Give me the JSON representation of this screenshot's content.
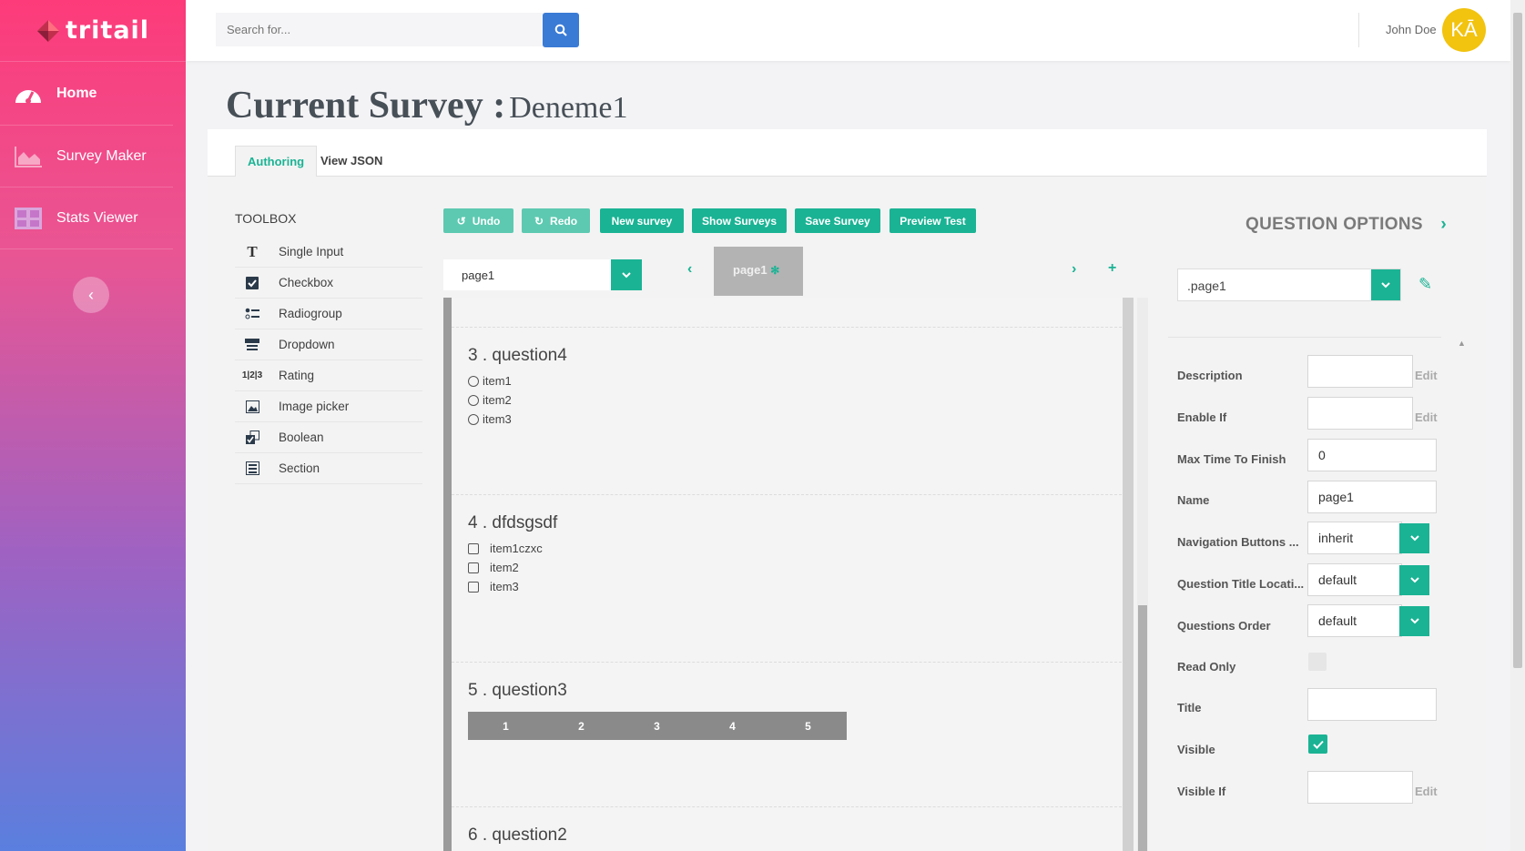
{
  "sidebar": {
    "logo_text": "tritail",
    "items": [
      {
        "label": "Home",
        "icon": "dashboard-gauge-icon"
      },
      {
        "label": "Survey Maker",
        "icon": "area-chart-icon"
      },
      {
        "label": "Stats Viewer",
        "icon": "grid-table-icon"
      }
    ],
    "collapse_icon": "chevron-left-icon"
  },
  "topbar": {
    "search_placeholder": "Search for...",
    "user_name": "John Doe",
    "avatar_initials": "KĀ",
    "avatar_color": "#f2c30f"
  },
  "page": {
    "title": "Current Survey :",
    "survey_name": "Deneme1"
  },
  "tabs": [
    {
      "label": "Authoring",
      "active": true
    },
    {
      "label": "View JSON",
      "active": false
    }
  ],
  "toolbox": {
    "title": "TOOLBOX",
    "items": [
      {
        "label": "Single Input",
        "icon": "text-t-icon"
      },
      {
        "label": "Checkbox",
        "icon": "checkbox-icon"
      },
      {
        "label": "Radiogroup",
        "icon": "radiogroup-icon"
      },
      {
        "label": "Dropdown",
        "icon": "dropdown-icon"
      },
      {
        "label": "Rating",
        "icon": "rating-icon"
      },
      {
        "label": "Image picker",
        "icon": "image-icon"
      },
      {
        "label": "Boolean",
        "icon": "boolean-icon"
      },
      {
        "label": "Section",
        "icon": "section-icon"
      }
    ]
  },
  "toolbar": {
    "undo": "Undo",
    "redo": "Redo",
    "new_survey": "New survey",
    "show_surveys": "Show Surveys",
    "save_survey": "Save Survey",
    "preview_test": "Preview Test"
  },
  "page_selector": {
    "value": "page1",
    "chip_label": "page1"
  },
  "questions": [
    {
      "number": "3 .",
      "title": "question4",
      "type": "radiogroup",
      "options": [
        "item1",
        "item2",
        "item3"
      ]
    },
    {
      "number": "4 .",
      "title": "dfdsgsdf",
      "type": "checkbox",
      "options": [
        "item1czxc",
        "item2",
        "item3"
      ]
    },
    {
      "number": "5 .",
      "title": "question3",
      "type": "rating",
      "options": [
        "1",
        "2",
        "3",
        "4",
        "5"
      ]
    },
    {
      "number": "6 .",
      "title": "question2",
      "type": "unknown",
      "options": []
    }
  ],
  "question_options": {
    "title": "QUESTION OPTIONS",
    "selector_value": ".page1",
    "edit_label": "Edit",
    "properties": {
      "description": {
        "label": "Description",
        "value": ""
      },
      "enable_if": {
        "label": "Enable If",
        "value": ""
      },
      "max_time": {
        "label": "Max Time To Finish",
        "value": "0"
      },
      "name": {
        "label": "Name",
        "value": "page1"
      },
      "nav_buttons": {
        "label": "Navigation Buttons ...",
        "value": "inherit"
      },
      "q_title_location": {
        "label": "Question Title Locati...",
        "value": "default"
      },
      "q_order": {
        "label": "Questions Order",
        "value": "default"
      },
      "read_only": {
        "label": "Read Only",
        "checked": false
      },
      "title": {
        "label": "Title",
        "value": ""
      },
      "visible": {
        "label": "Visible",
        "checked": true
      },
      "visible_if": {
        "label": "Visible If",
        "value": ""
      }
    }
  },
  "colors": {
    "accent": "#1ab394",
    "search_button": "#3a7bd5"
  }
}
